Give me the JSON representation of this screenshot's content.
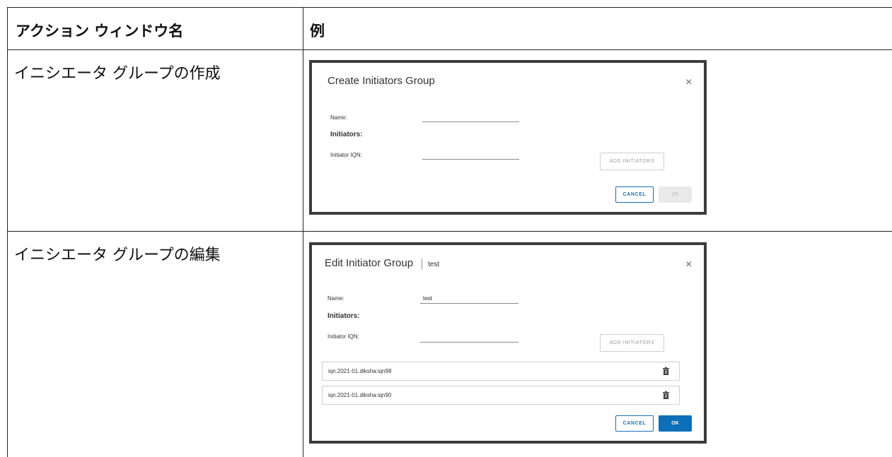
{
  "table": {
    "header": {
      "col1": "アクション ウィンドウ名",
      "col2": "例"
    },
    "rows": [
      {
        "name": "イニシエータ グループの作成"
      },
      {
        "name": "イニシエータ グループの編集"
      }
    ]
  },
  "create_dialog": {
    "title": "Create Initiators Group",
    "close_glyph": "×",
    "name_label": "Name:",
    "initiators_heading": "Initiators:",
    "iqn_label": "Initiator IQN:",
    "add_button": "ADD INITIATORS",
    "cancel_button": "CANCEL",
    "ok_button": "OK"
  },
  "edit_dialog": {
    "title": "Edit Initiator Group",
    "subtitle": "test",
    "close_glyph": "×",
    "name_label": "Name:",
    "name_value": "test",
    "initiators_heading": "Initiators:",
    "iqn_label": "Initiator IQN:",
    "add_button": "ADD INITIATORS",
    "initiators": [
      {
        "iqn": "iqn.2021-01.diksha:iqn98"
      },
      {
        "iqn": "iqn.2021-01.diksha:iqn90"
      }
    ],
    "cancel_button": "CANCEL",
    "ok_button": "OK"
  },
  "colors": {
    "accent_blue": "#0d6fb8",
    "border_dark": "#3c3c3c"
  }
}
